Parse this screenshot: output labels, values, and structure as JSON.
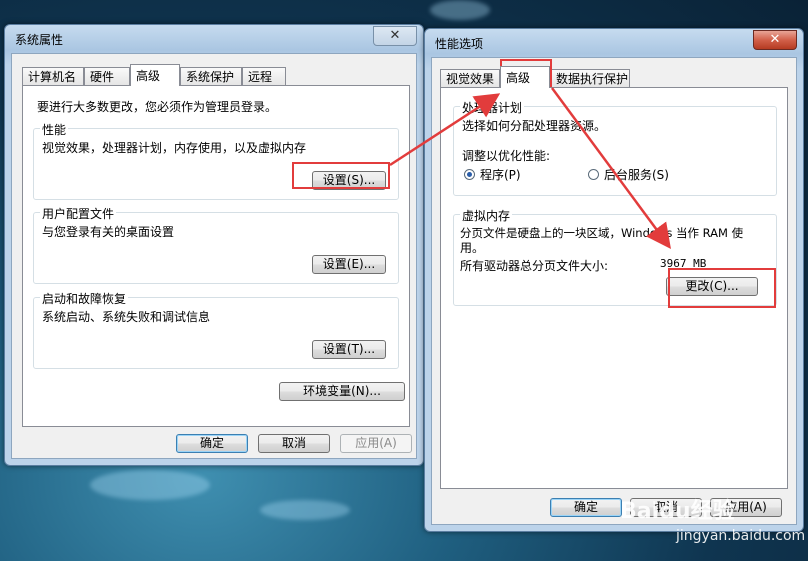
{
  "left_window": {
    "title": "系统属性",
    "tabs": [
      "计算机名",
      "硬件",
      "高级",
      "系统保护",
      "远程"
    ],
    "admin_note": "要进行大多数更改，您必须作为管理员登录。",
    "performance": {
      "label": "性能",
      "desc": "视觉效果，处理器计划，内存使用，以及虚拟内存",
      "button": "设置(S)..."
    },
    "user_profiles": {
      "label": "用户配置文件",
      "desc": "与您登录有关的桌面设置",
      "button": "设置(E)..."
    },
    "startup": {
      "label": "启动和故障恢复",
      "desc": "系统启动、系统失败和调试信息",
      "button": "设置(T)..."
    },
    "env_button": "环境变量(N)...",
    "ok": "确定",
    "cancel": "取消",
    "apply": "应用(A)",
    "close": "✕"
  },
  "right_window": {
    "title": "性能选项",
    "tabs": [
      "视觉效果",
      "高级",
      "数据执行保护"
    ],
    "scheduler": {
      "label": "处理器计划",
      "desc": "选择如何分配处理器资源。",
      "adjust": "调整以优化性能:",
      "opt_programs": "程序(P)",
      "opt_services": "后台服务(S)"
    },
    "vm": {
      "label": "虚拟内存",
      "desc_line1": "分页文件是硬盘上的一块区域，Windows 当作 RAM 使",
      "desc_line2": "用。",
      "total_label": "所有驱动器总分页文件大小:",
      "total_value": "3967 MB",
      "change_button": "更改(C)..."
    },
    "ok": "确定",
    "cancel": "取消",
    "apply": "应用(A)",
    "close": "✕"
  },
  "watermark": {
    "brand": "Baidu经验",
    "url": "jingyan.baidu.com"
  },
  "colors": {
    "highlight": "#e23c3c"
  }
}
